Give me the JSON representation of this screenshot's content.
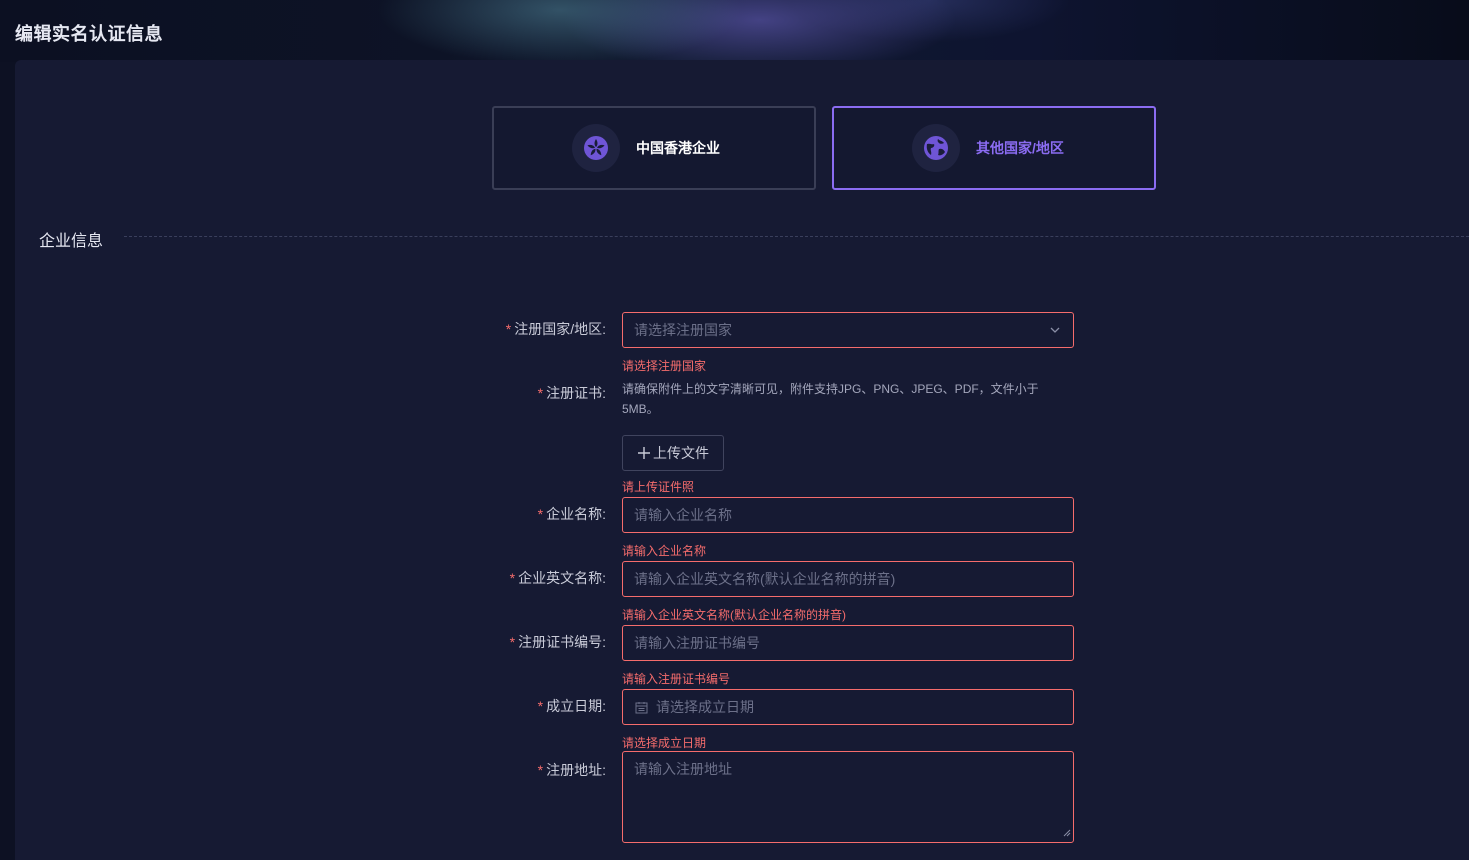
{
  "header": {
    "title": "编辑实名认证信息"
  },
  "region_tabs": [
    {
      "label": "中国香港企业",
      "icon": "bauhinia-icon",
      "selected": false
    },
    {
      "label": "其他国家/地区",
      "icon": "globe-icon",
      "selected": true
    }
  ],
  "section": {
    "title": "企业信息"
  },
  "form": {
    "country": {
      "label": "注册国家/地区:",
      "placeholder": "请选择注册国家",
      "error": "请选择注册国家"
    },
    "certificate": {
      "label": "注册证书:",
      "hint": "请确保附件上的文字清晰可见，附件支持JPG、PNG、JPEG、PDF，文件小于5MB。",
      "upload_label": "上传文件",
      "error": "请上传证件照"
    },
    "company_name": {
      "label": "企业名称:",
      "placeholder": "请输入企业名称",
      "error": "请输入企业名称"
    },
    "company_en_name": {
      "label": "企业英文名称:",
      "placeholder": "请输入企业英文名称(默认企业名称的拼音)",
      "error": "请输入企业英文名称(默认企业名称的拼音)"
    },
    "cert_number": {
      "label": "注册证书编号:",
      "placeholder": "请输入注册证书编号",
      "error": "请输入注册证书编号"
    },
    "founded_date": {
      "label": "成立日期:",
      "placeholder": "请选择成立日期",
      "error": "请选择成立日期"
    },
    "address": {
      "label": "注册地址:",
      "placeholder": "请输入注册地址"
    },
    "required_mark": "*"
  },
  "colors": {
    "accent": "#8b6cf2",
    "error": "#f56c6c",
    "panel": "#161a33",
    "background": "#0d1123"
  }
}
